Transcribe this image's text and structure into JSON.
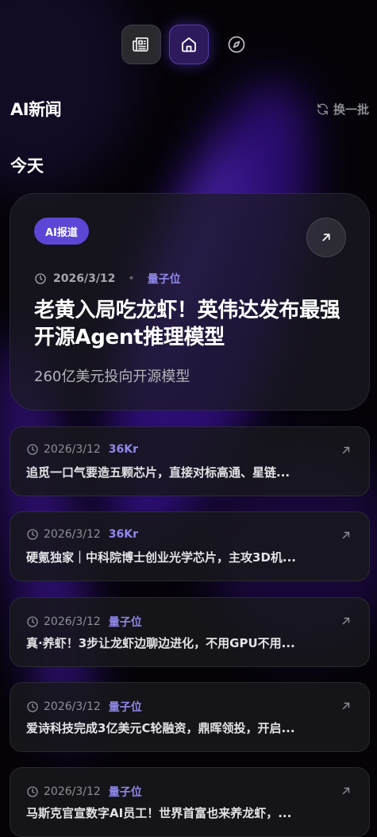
{
  "section": {
    "title": "AI新闻",
    "refresh_label": "换一批"
  },
  "day_label": "今天",
  "featured": {
    "badge": "AI报道",
    "date": "2026/3/12",
    "source": "量子位",
    "title": "老黄入局吃龙虾！英伟达发布最强开源Agent推理模型",
    "subtitle": "260亿美元投向开源模型"
  },
  "news": [
    {
      "date": "2026/3/12",
      "source": "36Kr",
      "title": "追觅一口气要造五颗芯片，直接对标高通、星链..."
    },
    {
      "date": "2026/3/12",
      "source": "36Kr",
      "title": "硬氪独家｜中科院博士创业光学芯片，主攻3D机..."
    },
    {
      "date": "2026/3/12",
      "source": "量子位",
      "title": "真·养虾！3步让龙虾边聊边进化，不用GPU不用..."
    },
    {
      "date": "2026/3/12",
      "source": "量子位",
      "title": "爱诗科技完成3亿美元C轮融资，鼎晖领投，开启..."
    },
    {
      "date": "2026/3/12",
      "source": "量子位",
      "title": "马斯克官宣数字AI员工！世界首富也来养龙虾，..."
    }
  ],
  "colors": {
    "accent": "#5b46d6",
    "source": "#8f88ea",
    "background": "#050308"
  },
  "icons": [
    "newspaper-icon",
    "home-icon",
    "compass-icon",
    "refresh-icon",
    "clock-icon",
    "external-arrow-icon"
  ]
}
